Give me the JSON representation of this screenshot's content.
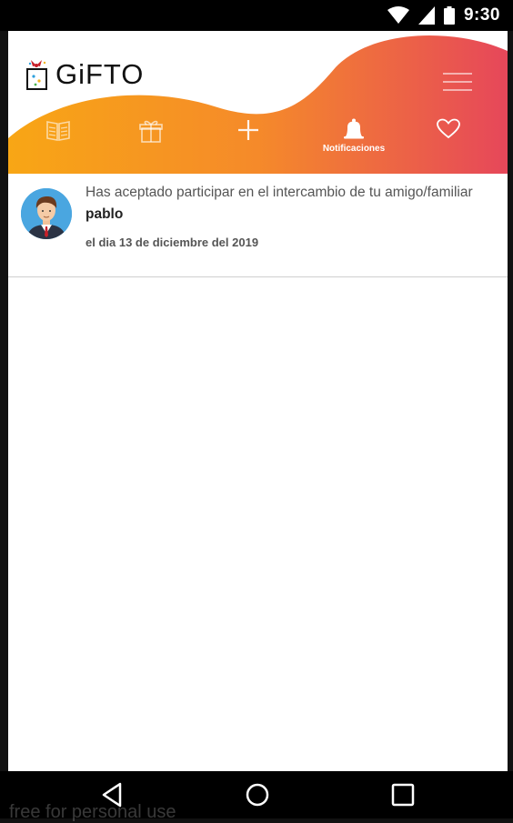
{
  "status_bar": {
    "time": "9:30",
    "icons": [
      "wifi-icon",
      "signal-icon",
      "battery-icon"
    ]
  },
  "app": {
    "name": "GiFTO"
  },
  "colors": {
    "gradient_start": "#f8a615",
    "gradient_mid": "#f07a3a",
    "gradient_end": "#e6475a"
  },
  "nav": {
    "items": [
      {
        "icon": "book-icon",
        "label": ""
      },
      {
        "icon": "gift-icon",
        "label": ""
      },
      {
        "icon": "plus-icon",
        "label": ""
      },
      {
        "icon": "bell-icon",
        "label": "Notificaciones",
        "active": true
      },
      {
        "icon": "heart-icon",
        "label": ""
      }
    ]
  },
  "notifications": [
    {
      "text": "Has aceptado participar en el intercambio de tu amigo/familiar",
      "name": "pablo",
      "date": "el dia 13 de diciembre del 2019"
    }
  ],
  "system_nav": {
    "back": "back-icon",
    "home": "home-icon",
    "recents": "recents-icon"
  },
  "watermark": "free for personal use"
}
